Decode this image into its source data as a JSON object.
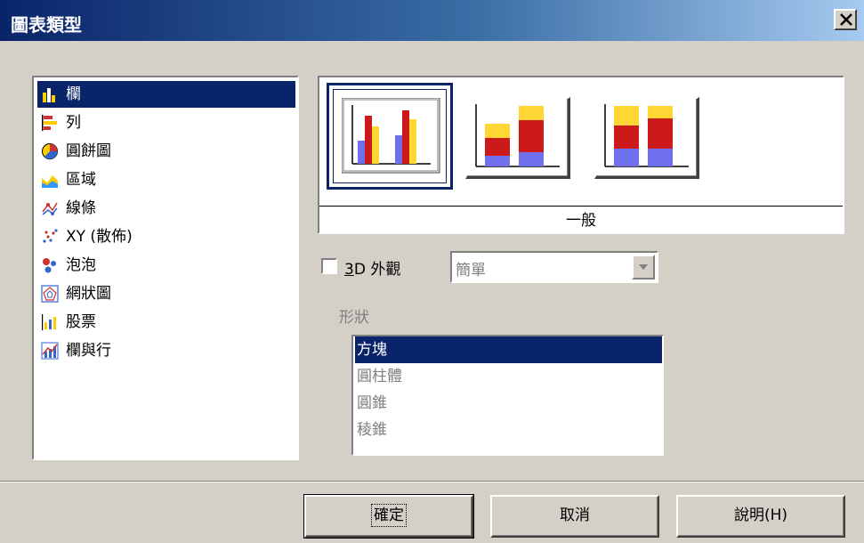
{
  "window": {
    "title": "圖表類型"
  },
  "chart_types": [
    {
      "label": "欄",
      "icon": "column-chart-icon",
      "selected": true
    },
    {
      "label": "列",
      "icon": "bar-chart-icon",
      "selected": false
    },
    {
      "label": "圓餅圖",
      "icon": "pie-chart-icon",
      "selected": false
    },
    {
      "label": "區域",
      "icon": "area-chart-icon",
      "selected": false
    },
    {
      "label": "線條",
      "icon": "line-chart-icon",
      "selected": false
    },
    {
      "label": "XY (散佈)",
      "icon": "scatter-chart-icon",
      "selected": false
    },
    {
      "label": "泡泡",
      "icon": "bubble-chart-icon",
      "selected": false
    },
    {
      "label": "網狀圖",
      "icon": "net-chart-icon",
      "selected": false
    },
    {
      "label": "股票",
      "icon": "stock-chart-icon",
      "selected": false
    },
    {
      "label": "欄與行",
      "icon": "column-line-chart-icon",
      "selected": false
    }
  ],
  "variants": {
    "caption": "一般",
    "items": [
      {
        "icon": "normal-column-icon",
        "selected": true
      },
      {
        "icon": "stacked-column-icon",
        "selected": false
      },
      {
        "icon": "percent-stacked-column-icon",
        "selected": false
      }
    ]
  },
  "appearance_3d": {
    "checkbox_label": "3D 外觀",
    "mnemonic": "3",
    "checked": false,
    "scheme_value": "簡單"
  },
  "shape": {
    "label": "形狀",
    "options": [
      "方塊",
      "圓柱體",
      "圓錐",
      "稜錐"
    ],
    "selected": "方塊"
  },
  "buttons": {
    "ok": "確定",
    "cancel": "取消",
    "help": "說明(H)"
  },
  "colors": {
    "title_start": "#0a246a",
    "title_end": "#a6caf0",
    "selection": "#0a246a",
    "face": "#d4d0c8",
    "bar_red": "#cc1a1a",
    "bar_yellow": "#ffd633",
    "bar_blue": "#7070ee"
  }
}
